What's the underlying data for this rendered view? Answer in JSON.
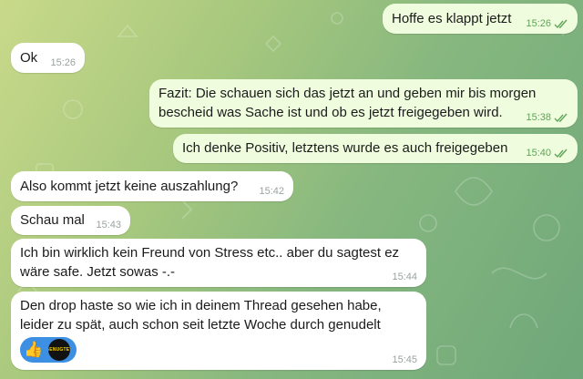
{
  "messages": [
    {
      "id": "m1",
      "direction": "out",
      "text": "Hoffe es klappt jetzt",
      "time": "15:26",
      "status": "read"
    },
    {
      "id": "m2",
      "direction": "in",
      "text": "Ok",
      "time": "15:26"
    },
    {
      "id": "m3",
      "direction": "out",
      "text": "Fazit: Die schauen sich das jetzt an und geben mir bis morgen\nbescheid was Sache ist und ob es jetzt freigegeben wird.",
      "time": "15:38",
      "status": "read"
    },
    {
      "id": "m4",
      "direction": "out",
      "text": "Ich denke Positiv, letztens wurde es auch freigegeben",
      "time": "15:40",
      "status": "read"
    },
    {
      "id": "m5",
      "direction": "in",
      "text": "Also kommt jetzt keine auszahlung?",
      "time": "15:42"
    },
    {
      "id": "m6",
      "direction": "in",
      "text": "Schau mal",
      "time": "15:43"
    },
    {
      "id": "m7",
      "direction": "in",
      "text": "Ich bin wirklich kein Freund von Stress etc.. aber du sagtest ez\nwäre safe. Jetzt sowas -.-",
      "time": "15:44"
    },
    {
      "id": "m8",
      "direction": "in",
      "text": "Den drop haste so wie ich in deinem Thread gesehen habe,\nleider zu spät, auch schon seit letzte Woche durch genudelt",
      "time": "15:45",
      "reactions": [
        {
          "emoji": "👍",
          "icon": "thumbs-up-icon",
          "reactor_avatar_label": "GENUGTEV"
        }
      ]
    }
  ],
  "colors": {
    "outgoing_bubble": "#effdde",
    "incoming_bubble": "#ffffff",
    "read_ticks": "#5fa458",
    "reaction_chip": "#3d8fe3"
  }
}
